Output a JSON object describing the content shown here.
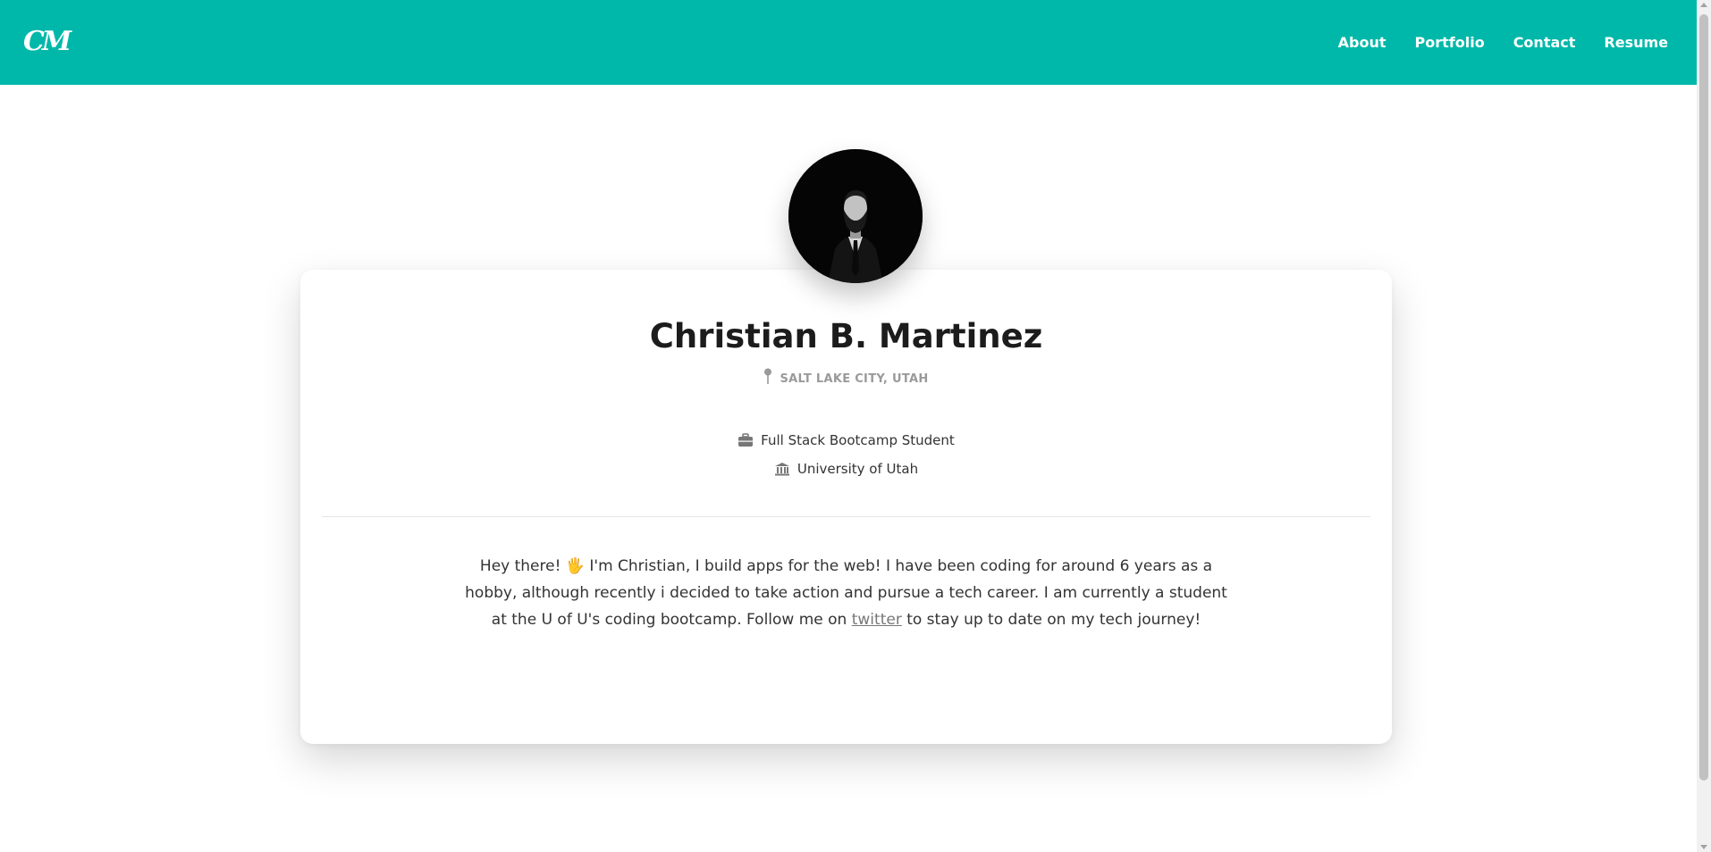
{
  "header": {
    "logo_text": "CM",
    "background_color": "#00b8a9",
    "nav": [
      "About",
      "Portfolio",
      "Contact",
      "Resume"
    ]
  },
  "profile": {
    "name": "Christian B. Martinez",
    "location": "SALT LAKE CITY, UTAH",
    "role": "Full Stack Bootcamp Student",
    "school": "University of Utah",
    "icons": {
      "location": "map-pin-icon",
      "role": "briefcase-icon",
      "school": "institution-icon"
    }
  },
  "bio": {
    "part1": "Hey there! ",
    "emoji": "🖐",
    "part2": " I'm Christian, I build apps for the web! I have been coding for around 6 years as a hobby, although recently i decided to take action and pursue a tech career. I am currently a student at the U of U's coding bootcamp. Follow me on ",
    "link_text": "twitter",
    "part3": " to stay up to date on my tech journey!"
  }
}
